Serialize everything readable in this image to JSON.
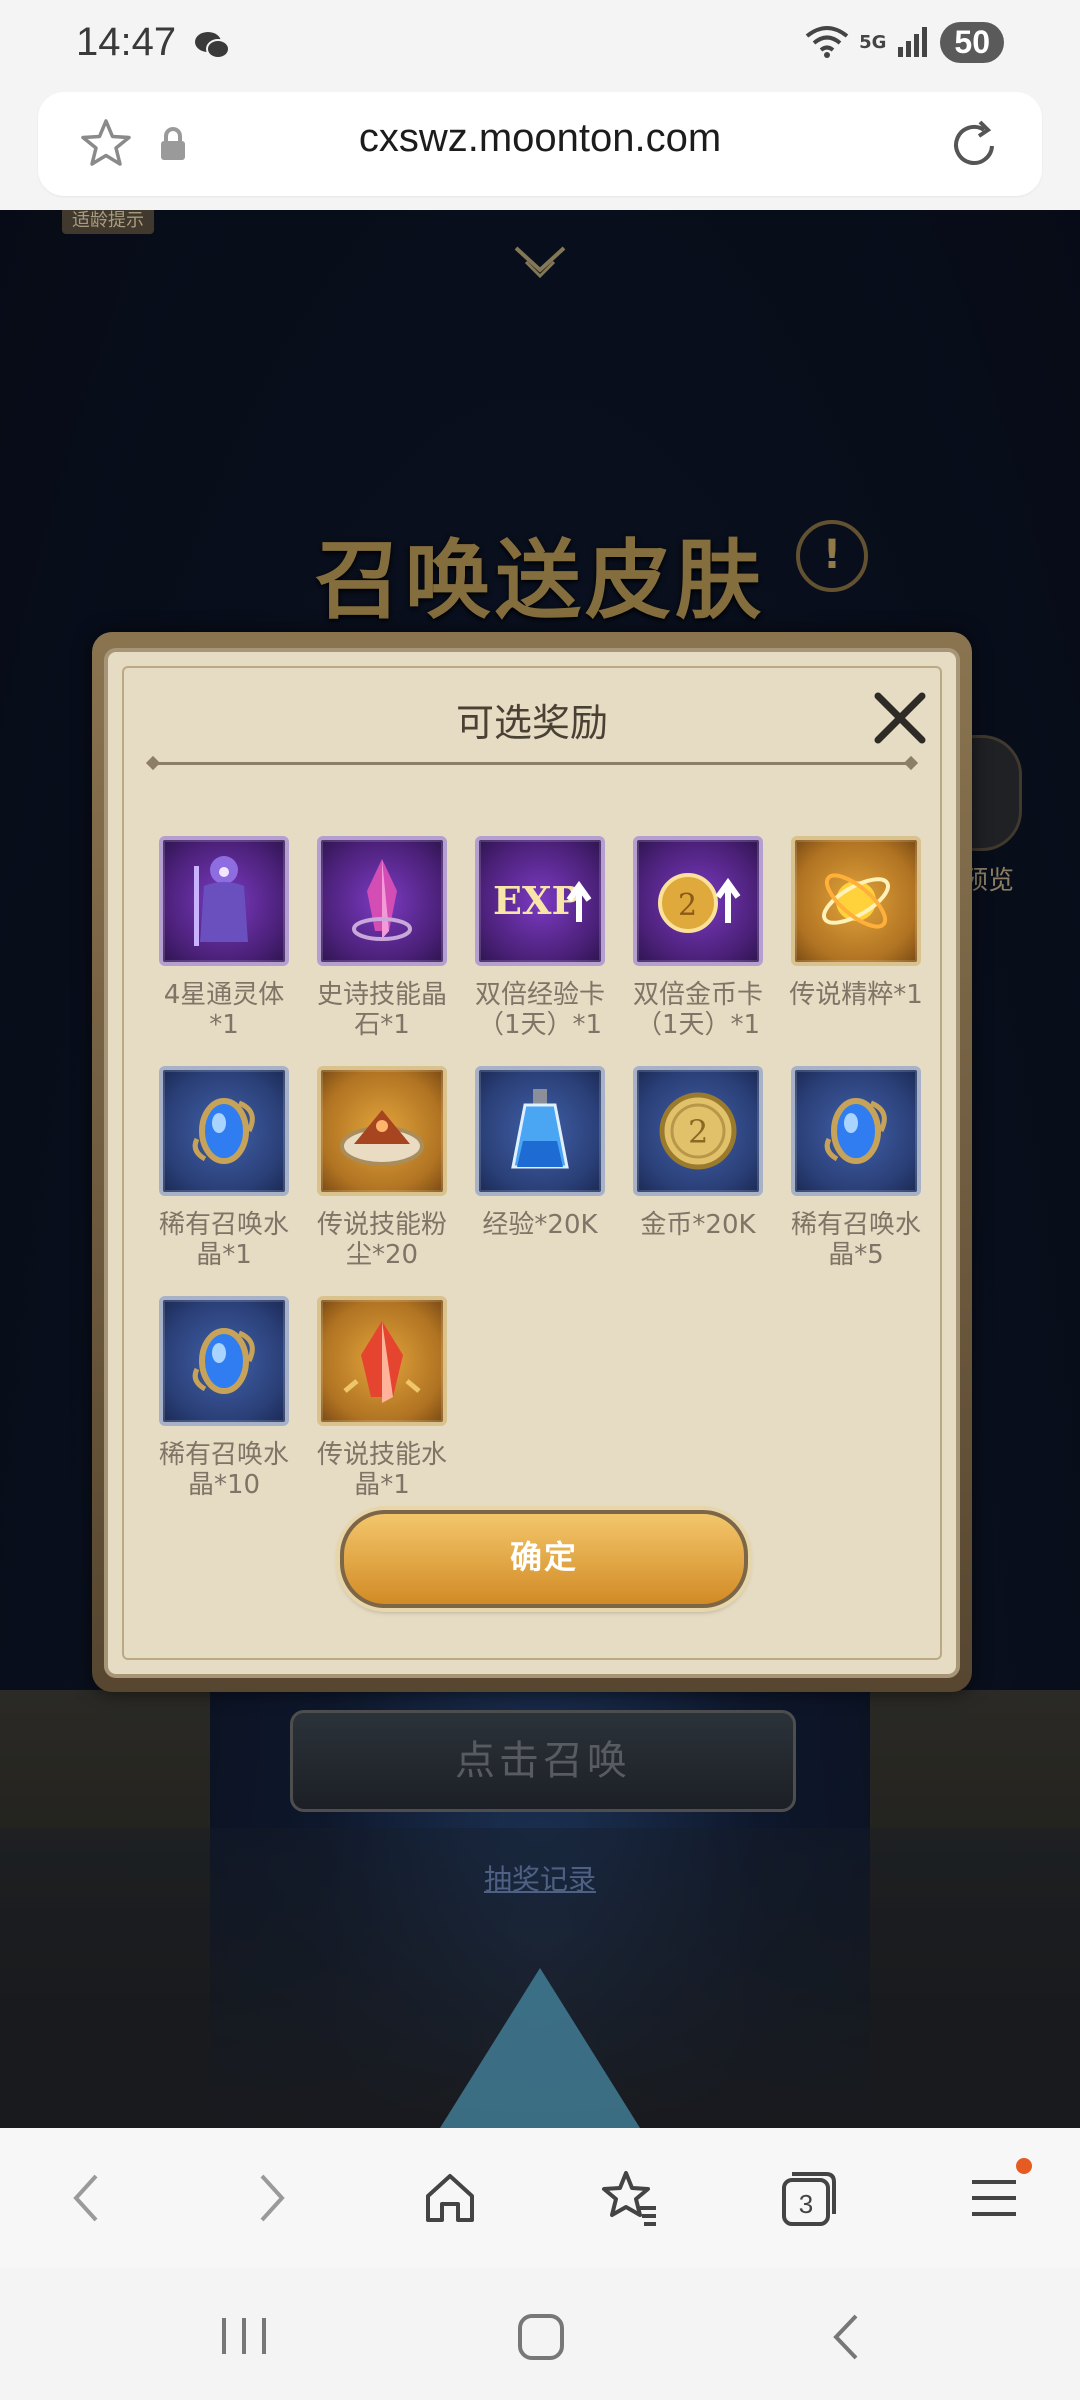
{
  "status_bar": {
    "time": "14:47",
    "network": "5G",
    "battery": "50"
  },
  "browser": {
    "url": "cxswz.moonton.com"
  },
  "page_background": {
    "notice_tag": "适龄提示",
    "title": "召唤送皮肤",
    "info_icon": "!",
    "preview_label": "预览",
    "summon_button": "点击召唤",
    "history_link": "抽奖记录"
  },
  "modal": {
    "title": "可选奖励",
    "items": [
      {
        "label": "4星通灵体*1",
        "icon": "spirit-knight-icon",
        "style": "purple"
      },
      {
        "label": "史诗技能晶石*1",
        "icon": "epic-crystal-icon",
        "style": "purple"
      },
      {
        "label": "双倍经验卡（1天）*1",
        "icon": "exp-card-icon",
        "style": "purple"
      },
      {
        "label": "双倍金币卡（1天）*1",
        "icon": "gold-card-icon",
        "style": "purple"
      },
      {
        "label": "传说精粹*1",
        "icon": "legend-essence-icon",
        "style": "gold"
      },
      {
        "label": "稀有召唤水晶*1",
        "icon": "rare-crystal-icon",
        "style": "blue"
      },
      {
        "label": "传说技能粉尘*20",
        "icon": "legend-dust-icon",
        "style": "gold"
      },
      {
        "label": "经验*20K",
        "icon": "exp-potion-icon",
        "style": "blue"
      },
      {
        "label": "金币*20K",
        "icon": "gold-coin-icon",
        "style": "blue"
      },
      {
        "label": "稀有召唤水晶*5",
        "icon": "rare-crystal-icon",
        "style": "blue"
      },
      {
        "label": "稀有召唤水晶*10",
        "icon": "rare-crystal-icon",
        "style": "blue"
      },
      {
        "label": "传说技能水晶*1",
        "icon": "legend-crystal-icon",
        "style": "gold"
      }
    ],
    "confirm_label": "确定"
  },
  "bottom_nav": {
    "tab_count": "3"
  }
}
